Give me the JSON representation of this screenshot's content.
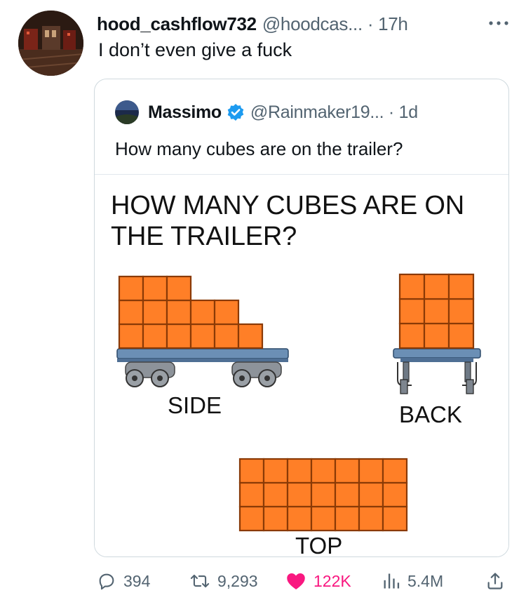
{
  "tweet": {
    "display_name": "hood_cashflow732",
    "handle_time": "@hoodcas... · 17h",
    "text": "I don’t even give a fuck"
  },
  "quoted_tweet": {
    "display_name": "Massimo",
    "handle_time": "@Rainmaker19... · 1d",
    "text": "How many cubes are on the trailer?",
    "image": {
      "title_line1": "HOW MANY CUBES ARE ON",
      "title_line2": "THE TRAILER?",
      "label_side": "SIDE",
      "label_back": "BACK",
      "label_top": "TOP",
      "side_columns_heights": [
        3,
        3,
        3,
        2,
        2,
        1
      ],
      "back_grid": {
        "cols": 3,
        "rows": 3
      },
      "top_grid": {
        "cols": 7,
        "rows": 3
      }
    }
  },
  "actions": {
    "replies": "394",
    "reposts": "9,293",
    "likes": "122K",
    "views": "5.4M"
  },
  "colors": {
    "cube_fill": "#ff7f27",
    "cube_stroke": "#8a3a06",
    "trailer_blue": "#6b8fb5",
    "like_pink": "#f91880",
    "verified_blue": "#1d9bf0"
  }
}
